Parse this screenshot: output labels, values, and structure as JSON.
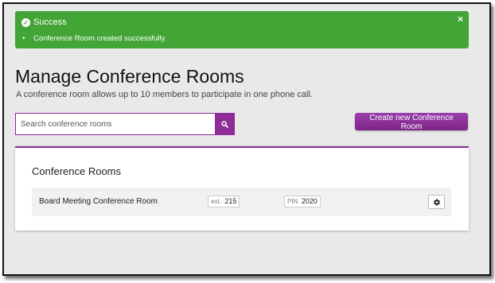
{
  "alert": {
    "title": "Success",
    "message": "Conference Room created successfully.",
    "bullet": "•",
    "close": "×"
  },
  "page": {
    "title": "Manage Conference Rooms",
    "subtitle": "A conference room allows up to 10 members to participate in one phone call."
  },
  "search": {
    "placeholder": "Search conference rooms",
    "icon": "search-icon"
  },
  "toolbar": {
    "create_label": "Create new Conference Room"
  },
  "panel": {
    "title": "Conference Rooms",
    "rooms": [
      {
        "name": "Board Meeting Conference Room",
        "ext_label": "ext.",
        "ext": "215",
        "pin_label": "PIN",
        "pin": "2020",
        "settings_icon": "gear-icon"
      }
    ]
  },
  "colors": {
    "success": "#43a535",
    "accent": "#8a2a92",
    "background": "#e9e9e9"
  }
}
